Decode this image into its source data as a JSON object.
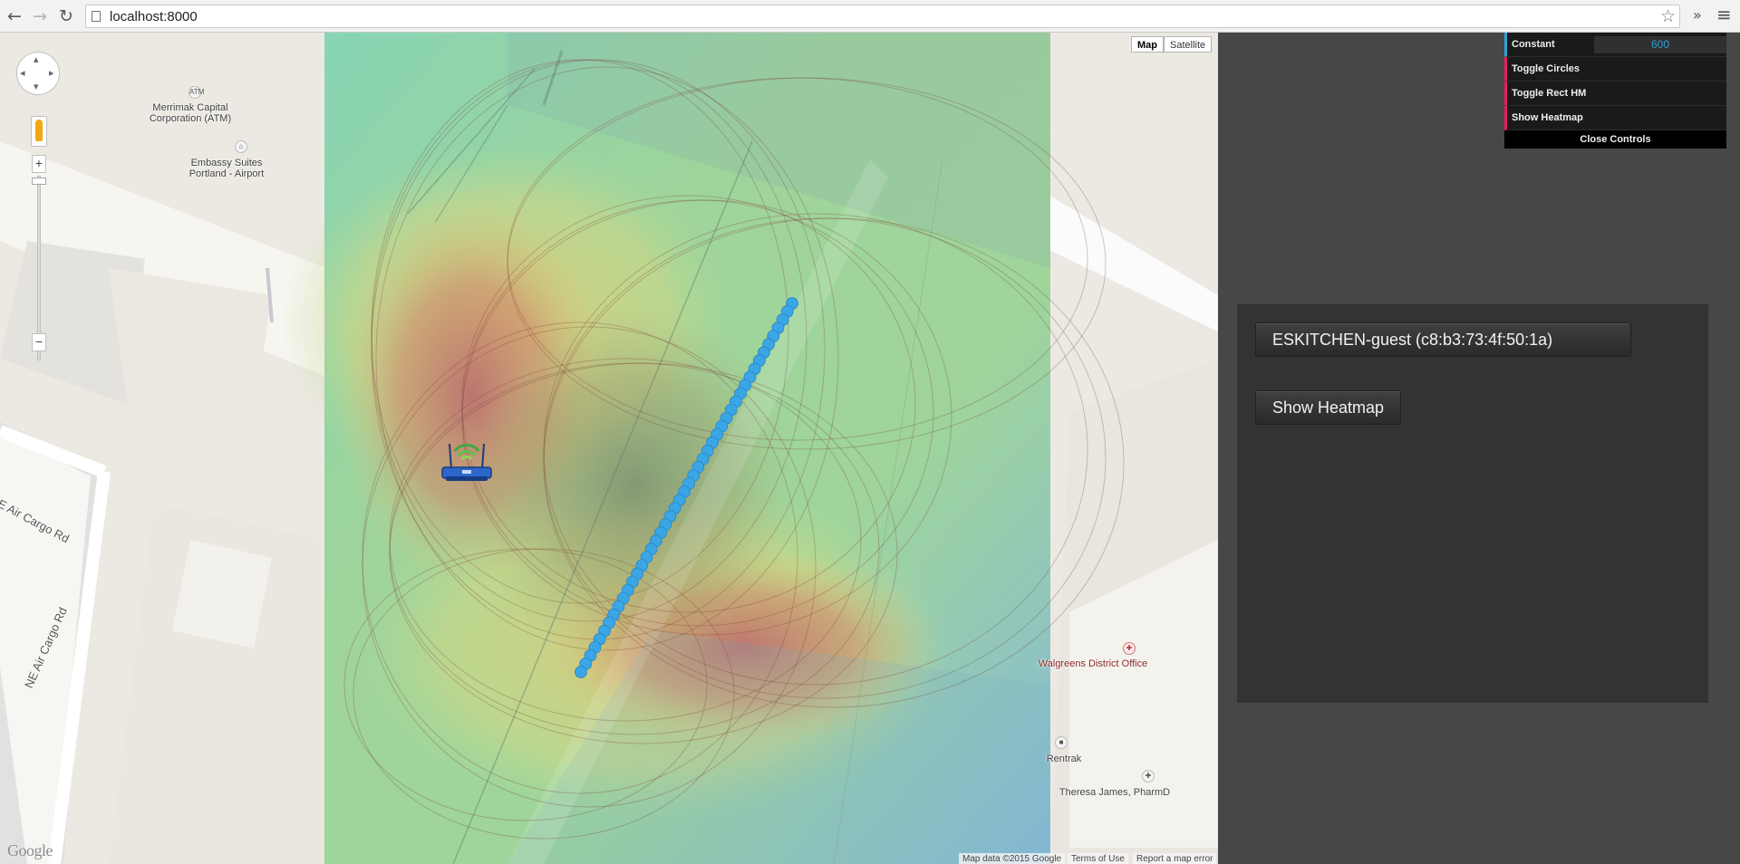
{
  "browser": {
    "url": "localhost:8000",
    "back_icon": "←",
    "forward_icon": "→",
    "reload_icon": "↻",
    "star_icon": "☆",
    "extensions_icon": "»",
    "menu_icon": "≡"
  },
  "map": {
    "map_type_buttons": [
      {
        "label": "Map",
        "selected": true
      },
      {
        "label": "Satellite",
        "selected": false
      }
    ],
    "zoom_in_label": "+",
    "zoom_out_label": "−",
    "pois": [
      {
        "name": "Merrimak Capital\nCorporation (ATM)",
        "icon": "ATM"
      },
      {
        "name": "Embassy Suites\nPortland - Airport",
        "icon": "hotel-icon"
      },
      {
        "name": "Walgreens District Office",
        "icon": "pharmacy-icon"
      },
      {
        "name": "Rentrak",
        "icon": "building-icon"
      },
      {
        "name": "Theresa James, PharmD",
        "icon": "medical-icon"
      }
    ],
    "streets": [
      "NE Air Cargo Rd",
      "NE Air Cargo Rd"
    ],
    "google_logo": "Google",
    "attribution": {
      "map_data": "Map data ©2015 Google",
      "terms": "Terms of Use",
      "report": "Report a map error"
    },
    "overlay": {
      "heatmap_colors": [
        "#6fb6e8",
        "#8fd49a",
        "#e6d982",
        "#c97a6d",
        "#b57a5a"
      ],
      "track_point_color": "#3aa6e6",
      "router_icon": "wifi-router-icon"
    }
  },
  "controls": {
    "constant_label": "Constant",
    "constant_value": "600",
    "toggle_circles_label": "Toggle Circles",
    "toggle_rect_label": "Toggle Rect HM",
    "show_heatmap_label": "Show Heatmap",
    "close_label": "Close Controls"
  },
  "panel": {
    "network_label": "ESKITCHEN-guest (c8:b3:73:4f:50:1a)",
    "show_heatmap_label": "Show Heatmap"
  }
}
